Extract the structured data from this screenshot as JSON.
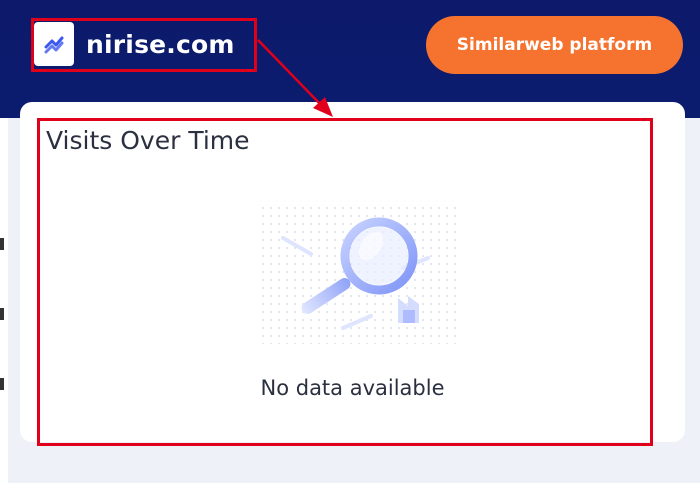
{
  "site": {
    "domain": "nirise.com",
    "favicon_icon": "trend-chart-icon"
  },
  "header": {
    "platform_button_label": "Similarweb platform"
  },
  "card": {
    "title": "Visits Over Time",
    "empty_state_text": "No data available",
    "empty_state_icon": "magnifying-glass-icon"
  },
  "colors": {
    "header_bg": "#0d1a6b",
    "accent_button": "#f5732f",
    "annotation_red": "#e0001b"
  }
}
